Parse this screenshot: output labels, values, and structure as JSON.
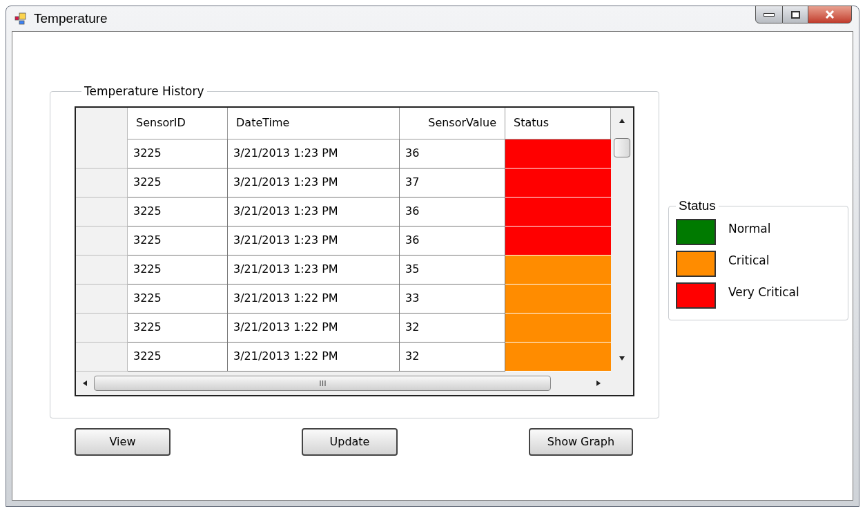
{
  "window": {
    "title": "Temperature"
  },
  "history": {
    "title": "Temperature History",
    "columns": [
      "SensorID",
      "DateTime",
      "SensorValue",
      "Status"
    ],
    "rows": [
      {
        "sensor_id": "3225",
        "date_time": "3/21/2013 1:23 PM",
        "value": "36",
        "color": "#ff0000"
      },
      {
        "sensor_id": "3225",
        "date_time": "3/21/2013 1:23 PM",
        "value": "37",
        "color": "#ff0000"
      },
      {
        "sensor_id": "3225",
        "date_time": "3/21/2013 1:23 PM",
        "value": "36",
        "color": "#ff0000"
      },
      {
        "sensor_id": "3225",
        "date_time": "3/21/2013 1:23 PM",
        "value": "36",
        "color": "#ff0000"
      },
      {
        "sensor_id": "3225",
        "date_time": "3/21/2013 1:23 PM",
        "value": "35",
        "color": "#ff8c00"
      },
      {
        "sensor_id": "3225",
        "date_time": "3/21/2013 1:22 PM",
        "value": "33",
        "color": "#ff8c00"
      },
      {
        "sensor_id": "3225",
        "date_time": "3/21/2013 1:22 PM",
        "value": "32",
        "color": "#ff8c00"
      },
      {
        "sensor_id": "3225",
        "date_time": "3/21/2013 1:22 PM",
        "value": "32",
        "color": "#ff8c00"
      }
    ]
  },
  "buttons": [
    "View",
    "Update",
    "Show Graph"
  ],
  "legend": {
    "title": "Status",
    "items": [
      {
        "label": "Normal",
        "color": "#007a00"
      },
      {
        "label": "Critical",
        "color": "#ff8c00"
      },
      {
        "label": "Very Critical",
        "color": "#ff0000"
      }
    ]
  }
}
